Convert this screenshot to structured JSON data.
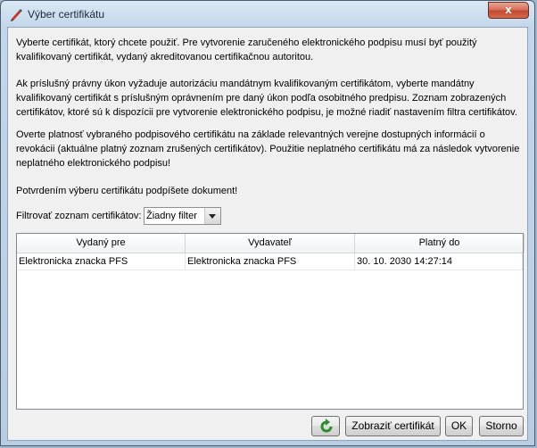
{
  "window": {
    "title": "Výber certifikátu",
    "close_label": "x"
  },
  "info": {
    "p1": "Vyberte certifikát, ktorý chcete použiť. Pre vytvorenie zaručeného elektronického podpisu musí byť použitý kvalifikovaný certifikát, vydaný akreditovanou certifikačnou autoritou.",
    "p2": "Ak príslušný právny úkon vyžaduje autorizáciu mandátnym kvalifikovaným certifikátom, vyberte mandátny kvalifikovaný certifikát s príslušným oprávnením pre daný úkon podľa osobitného predpisu. Zoznam zobrazených certifikátov, ktoré sú k dispozícii pre vytvorenie elektronického podpisu, je možné riadiť nastavením filtra certifikátov.",
    "p3": "Overte platnosť vybraného podpisového certifikátu na základe relevantných verejne dostupných informácií o revokácii (aktuálne platný zoznam zrušených certifikátov). Použitie neplatného certifikátu má za následok vytvorenie neplatného elektronického podpisu!",
    "p4": "Potvrdením výberu certifikátu podpíšete dokument!"
  },
  "filter": {
    "label": "Filtrovať zoznam certifikátov:",
    "value": "Žiadny filter"
  },
  "table": {
    "columns": [
      "Vydaný pre",
      "Vydavateľ",
      "Platný do"
    ],
    "rows": [
      [
        "Elektronicka znacka PFS",
        "Elektronicka znacka PFS",
        "30. 10. 2030 14:27:14"
      ]
    ]
  },
  "buttons": {
    "refresh_icon": "refresh-icon",
    "show_certificate": "Zobraziť certifikát",
    "ok": "OK",
    "cancel": "Storno"
  },
  "colors": {
    "close_button": "#c24a32",
    "refresh_icon": "#2e8b2e"
  }
}
